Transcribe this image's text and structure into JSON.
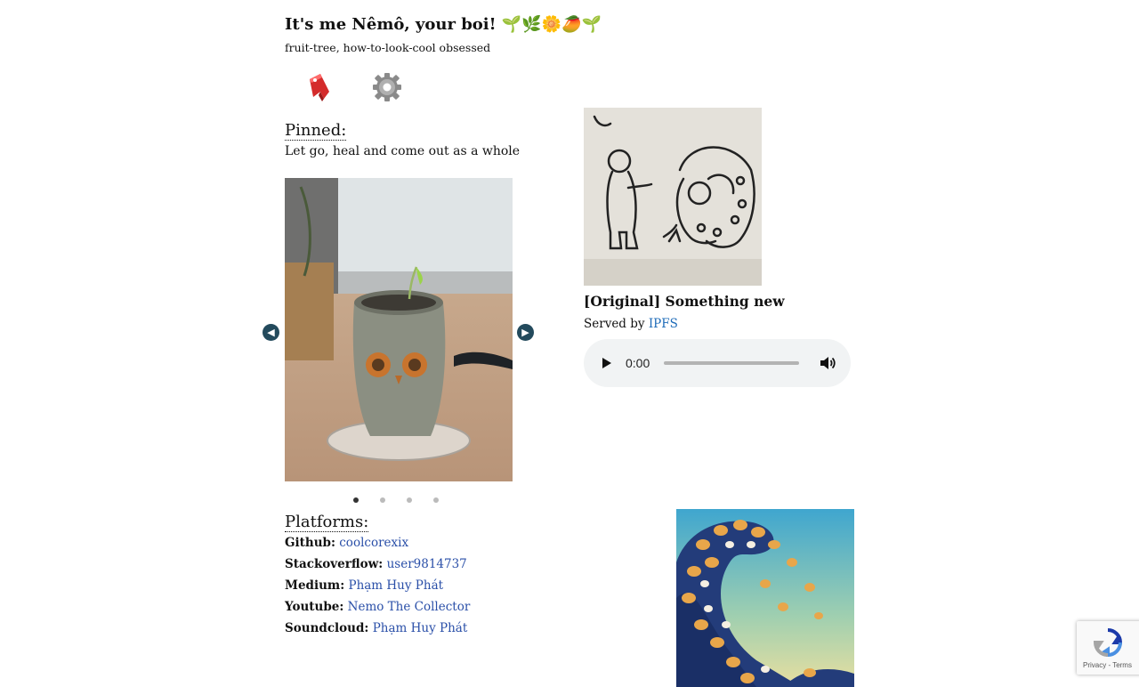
{
  "header": {
    "title": "It's me Nêmô, your boi! 🌱🌿🌼🥭🌱",
    "subtitle": "fruit-tree, how-to-look-cool obsessed"
  },
  "toolbar": {
    "bookmark_icon": "bookmark-ribbon-icon",
    "settings_icon": "gear-icon"
  },
  "pinned": {
    "heading": "Pinned:",
    "text": "Let go, heal and come out as a whole"
  },
  "carousel": {
    "prev_icon": "chevron-left-circle-icon",
    "next_icon": "chevron-right-circle-icon",
    "slide_count": 4,
    "active_index": 0
  },
  "music": {
    "title": "[Original] Something new",
    "served_by_label": "Served by",
    "served_by_link": "IPFS",
    "player": {
      "time": "0:00",
      "progress": 0
    }
  },
  "platforms": {
    "heading": "Platforms:",
    "items": [
      {
        "name": "Github:",
        "value": "coolcorexix"
      },
      {
        "name": "Stackoverflow:",
        "value": "user9814737"
      },
      {
        "name": "Medium:",
        "value": "Phạm Huy Phát"
      },
      {
        "name": "Youtube:",
        "value": "Nemo The Collector"
      },
      {
        "name": "Soundcloud:",
        "value": "Phạm Huy Phát"
      }
    ]
  },
  "recaptcha": {
    "footer": "Privacy - Terms"
  },
  "colors": {
    "link": "#2a4fa8",
    "arrow": "#234a5c",
    "player_bg": "#f1f3f4"
  }
}
